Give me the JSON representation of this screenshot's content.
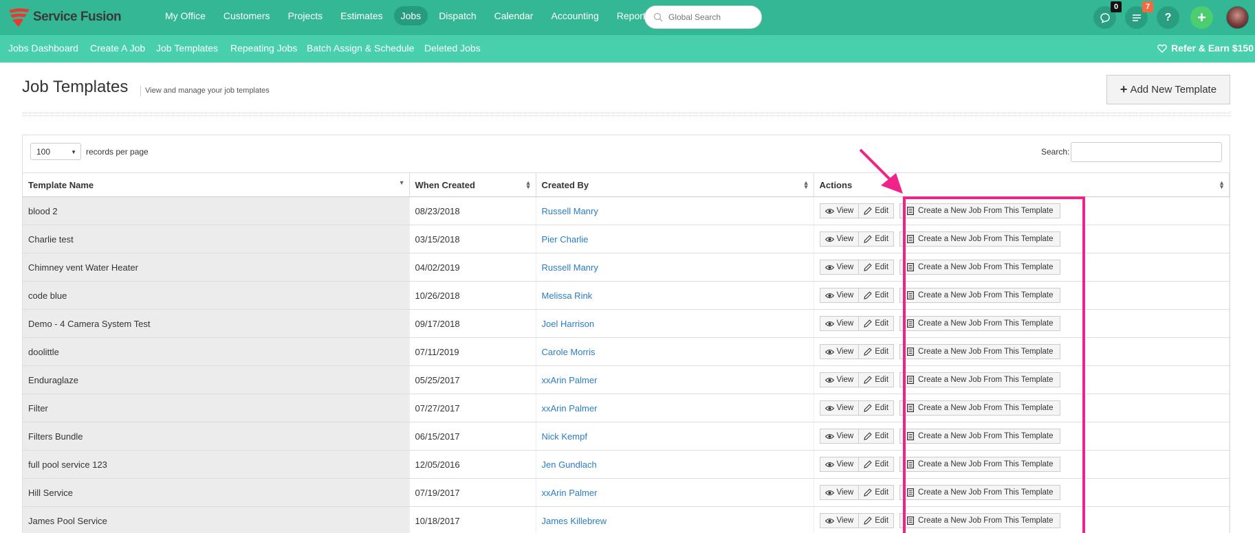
{
  "brand": {
    "name": "Service Fusion"
  },
  "main_nav": [
    {
      "label": "My Office",
      "active": false
    },
    {
      "label": "Customers",
      "active": false
    },
    {
      "label": "Projects",
      "active": false
    },
    {
      "label": "Estimates",
      "active": false
    },
    {
      "label": "Jobs",
      "active": true
    },
    {
      "label": "Dispatch",
      "active": false
    },
    {
      "label": "Calendar",
      "active": false
    },
    {
      "label": "Accounting",
      "active": false
    },
    {
      "label": "Reports",
      "active": false
    }
  ],
  "global_search": {
    "placeholder": "Global Search"
  },
  "header_icons": {
    "chat_badge": "0",
    "tasks_badge": "7",
    "help_label": "?",
    "add_label": "+"
  },
  "sub_nav": [
    {
      "label": "Jobs Dashboard"
    },
    {
      "label": "Create A Job"
    },
    {
      "label": "Job Templates"
    },
    {
      "label": "Repeating Jobs"
    },
    {
      "label": "Batch Assign & Schedule"
    },
    {
      "label": "Deleted Jobs"
    }
  ],
  "refer": {
    "label": "Refer & Earn $150"
  },
  "page": {
    "title": "Job Templates",
    "subtitle": "View and manage your job templates",
    "add_button": "Add New Template"
  },
  "table_controls": {
    "records_value": "100",
    "records_label": "records per page",
    "search_label": "Search:"
  },
  "columns": [
    "Template Name",
    "When Created",
    "Created By",
    "Actions"
  ],
  "actions": {
    "view": "View",
    "edit": "Edit",
    "create": "Create a New Job From This Template"
  },
  "rows": [
    {
      "name": "blood 2",
      "when": "08/23/2018",
      "by": "Russell Manry"
    },
    {
      "name": "Charlie test",
      "when": "03/15/2018",
      "by": "Pier Charlie"
    },
    {
      "name": "Chimney vent Water Heater",
      "when": "04/02/2019",
      "by": "Russell Manry"
    },
    {
      "name": "code blue",
      "when": "10/26/2018",
      "by": "Melissa Rink"
    },
    {
      "name": "Demo - 4 Camera System Test",
      "when": "09/17/2018",
      "by": "Joel Harrison"
    },
    {
      "name": "doolittle",
      "when": "07/11/2019",
      "by": "Carole Morris"
    },
    {
      "name": "Enduraglaze",
      "when": "05/25/2017",
      "by": "xxArin Palmer"
    },
    {
      "name": "Filter",
      "when": "07/27/2017",
      "by": "xxArin Palmer"
    },
    {
      "name": "Filters Bundle",
      "when": "06/15/2017",
      "by": "Nick Kempf"
    },
    {
      "name": "full pool service 123",
      "when": "12/05/2016",
      "by": "Jen Gundlach"
    },
    {
      "name": "Hill Service",
      "when": "07/19/2017",
      "by": "xxArin Palmer"
    },
    {
      "name": "James Pool Service",
      "when": "10/18/2017",
      "by": "James Killebrew"
    }
  ],
  "colors": {
    "topbar": "#34b794",
    "subnav": "#48d0ad",
    "link": "#2a7cc4",
    "annotation": "#f0238a",
    "tasks_badge": "#f26a3d"
  }
}
